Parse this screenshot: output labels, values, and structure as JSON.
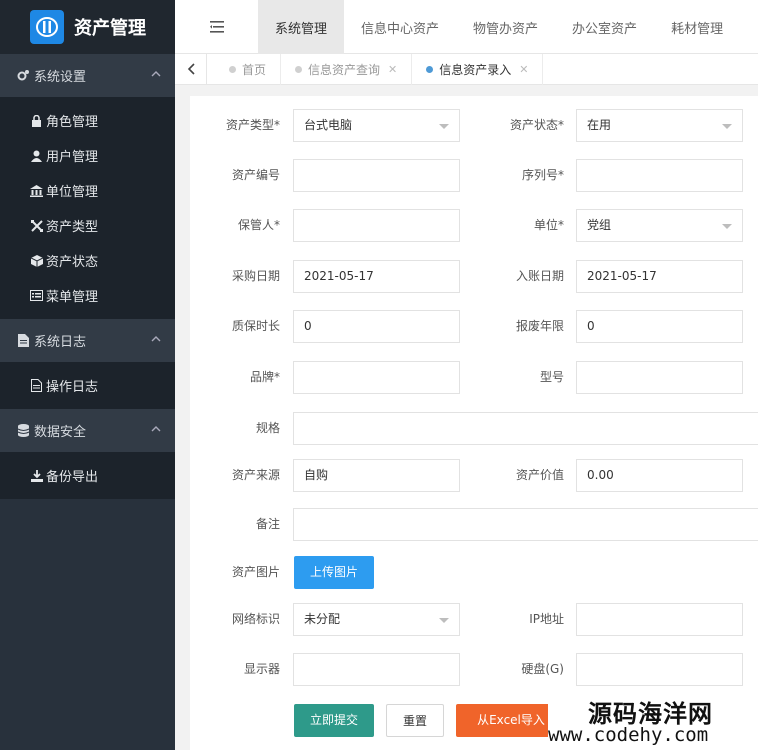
{
  "app": {
    "title": "资产管理"
  },
  "sidebar": {
    "groups": [
      {
        "label": "系统设置",
        "items": [
          "角色管理",
          "用户管理",
          "单位管理",
          "资产类型",
          "资产状态",
          "菜单管理"
        ]
      },
      {
        "label": "系统日志",
        "items": [
          "操作日志"
        ]
      },
      {
        "label": "数据安全",
        "items": [
          "备份导出"
        ]
      }
    ]
  },
  "topnav": {
    "items": [
      "系统管理",
      "信息中心资产",
      "物管办资产",
      "办公室资产",
      "耗材管理"
    ],
    "active": "系统管理"
  },
  "tabs": {
    "items": [
      "首页",
      "信息资产查询",
      "信息资产录入"
    ]
  },
  "form": {
    "asset_type": {
      "label": "资产类型*",
      "value": "台式电脑"
    },
    "asset_status": {
      "label": "资产状态*",
      "value": "在用"
    },
    "asset_no": {
      "label": "资产编号",
      "value": ""
    },
    "serial_no": {
      "label": "序列号*",
      "value": ""
    },
    "custodian": {
      "label": "保管人*",
      "value": ""
    },
    "unit": {
      "label": "单位*",
      "value": "党组"
    },
    "purchase_date": {
      "label": "采购日期",
      "value": "2021-05-17"
    },
    "entry_date": {
      "label": "入账日期",
      "value": "2021-05-17"
    },
    "warranty": {
      "label": "质保时长",
      "value": "0"
    },
    "scrap_years": {
      "label": "报废年限",
      "value": "0"
    },
    "brand": {
      "label": "品牌*",
      "value": ""
    },
    "model": {
      "label": "型号",
      "value": ""
    },
    "spec": {
      "label": "规格",
      "value": ""
    },
    "source": {
      "label": "资产来源",
      "value": "自购"
    },
    "value": {
      "label": "资产价值",
      "value": "0.00"
    },
    "remark": {
      "label": "备注",
      "value": ""
    },
    "image": {
      "label": "资产图片",
      "button": "上传图片"
    },
    "network": {
      "label": "网络标识",
      "value": "未分配"
    },
    "ip": {
      "label": "IP地址",
      "value": ""
    },
    "monitor": {
      "label": "显示器",
      "value": ""
    },
    "disk": {
      "label": "硬盘(G)",
      "value": ""
    }
  },
  "buttons": {
    "submit": "立即提交",
    "reset": "重置",
    "excel": "从Excel导入"
  },
  "watermark": {
    "line1": "源码海洋网",
    "line2": "www.codehy.com"
  }
}
